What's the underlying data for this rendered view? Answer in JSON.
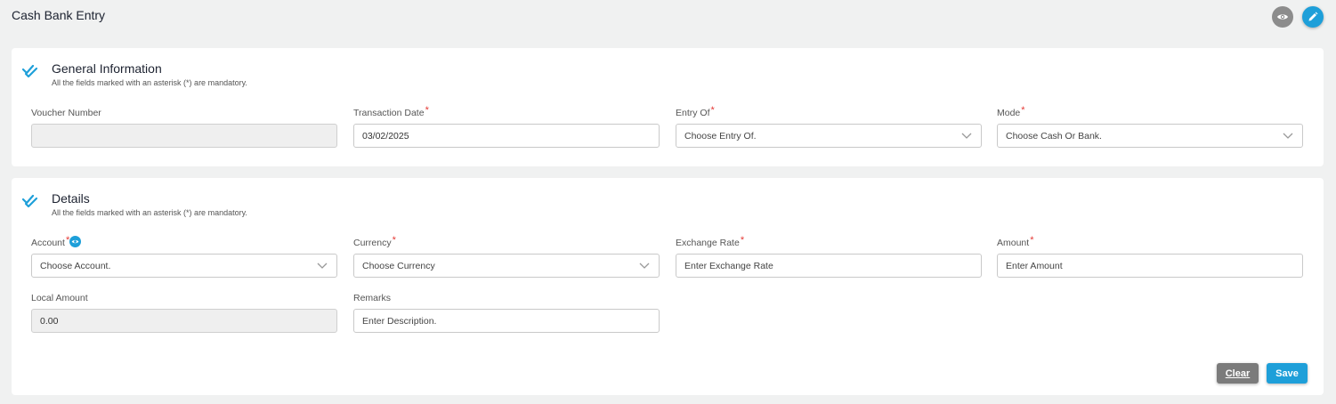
{
  "page": {
    "title": "Cash Bank Entry"
  },
  "header_actions": {
    "view_icon": "eye-icon",
    "edit_icon": "pencil-icon"
  },
  "colors": {
    "accent": "#1e9fd9",
    "required": "#e53935",
    "clear_button": "#7b7b7b"
  },
  "general": {
    "title": "General Information",
    "subtitle": "All the fields marked with an asterisk (*) are mandatory.",
    "fields": [
      {
        "label": "Voucher Number",
        "value": "",
        "required": false,
        "disabled": true
      },
      {
        "label": "Transaction Date",
        "value": "03/02/2025",
        "required": true
      },
      {
        "label": "Entry Of",
        "placeholder": "Choose Entry Of.",
        "required": true,
        "type": "select"
      },
      {
        "label": "Mode",
        "placeholder": "Choose Cash Or Bank.",
        "required": true,
        "type": "select"
      }
    ]
  },
  "details": {
    "title": "Details",
    "subtitle": "All the fields marked with an asterisk (*) are mandatory.",
    "fields": [
      {
        "label": "Account",
        "placeholder": "Choose Account.",
        "required": true,
        "type": "select"
      },
      {
        "label": "Currency",
        "placeholder": "Choose Currency",
        "required": true,
        "type": "select"
      },
      {
        "label": "Exchange Rate",
        "placeholder": "Enter Exchange Rate",
        "required": true
      },
      {
        "label": "Amount",
        "placeholder": "Enter Amount",
        "required": true
      },
      {
        "label": "Local Amount",
        "value": "0.00",
        "required": false,
        "disabled": true
      },
      {
        "label": "Remarks",
        "placeholder": "Enter Description.",
        "required": false
      }
    ]
  },
  "actions": {
    "clear_label": "Clear",
    "save_label": "Save"
  },
  "required_mark": "*"
}
